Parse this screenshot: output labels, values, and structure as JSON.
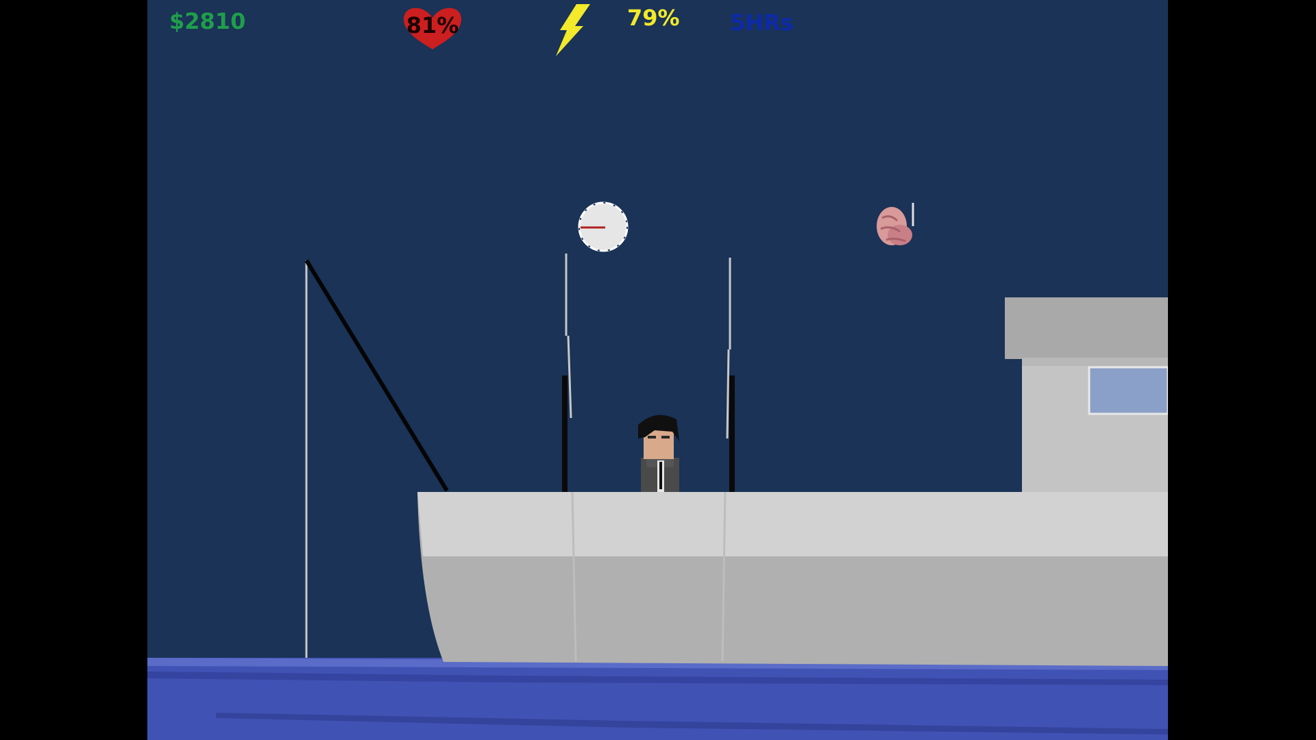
{
  "hud": {
    "money": "$2810",
    "health": "81%",
    "energy": "79%",
    "time": "5HRs"
  },
  "icons": {
    "health": "heart-icon",
    "energy": "lightning-bolt-icon",
    "clock": "clock-icon",
    "item": "brain-icon"
  },
  "colors": {
    "sky": "#1a3357",
    "money": "#1f9e4a",
    "health_heart": "#cc1f1f",
    "health_text": "#1a0000",
    "energy": "#f2ea2a",
    "time": "#0c2aa8",
    "ship_deck": "#d2d2d2",
    "ship_hull": "#b0b0b0",
    "sea": "#4152b5"
  }
}
